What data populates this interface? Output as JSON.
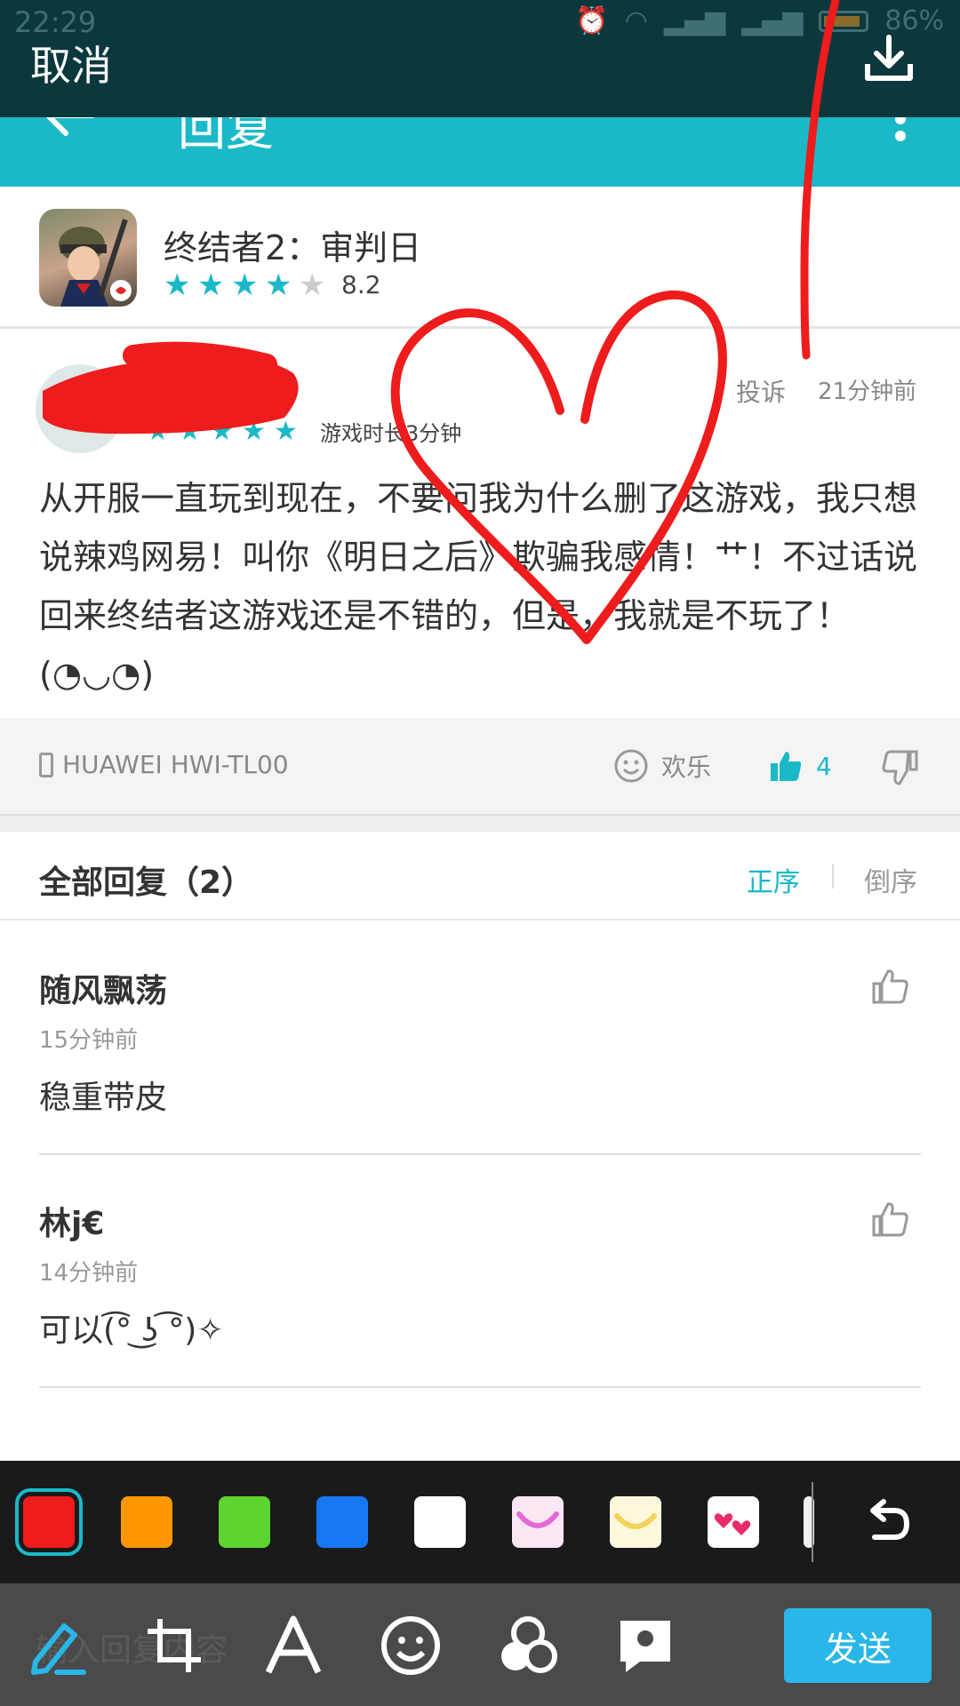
{
  "status_bar": {
    "time": "22:29",
    "battery": "86%"
  },
  "editor": {
    "cancel_label": "取消",
    "send_label": "发送"
  },
  "app_header": {
    "title": "回复"
  },
  "game": {
    "name": "终结者2：审判日",
    "score": "8.2",
    "rating_stars": 4
  },
  "review": {
    "playtime": "游戏时长3分钟",
    "report_label": "投诉",
    "time": "21分钟前",
    "text": "从开服一直玩到现在，不要问我为什么删了这游戏，我只想说辣鸡网易！叫你《明日之后》欺骗我感情！艹！不过话说回来终结者这游戏还是不错的，但是，我就是不玩了！(◔◡◔)",
    "stars": 5
  },
  "device_bar": {
    "device": "HUAWEI HWI-TL00",
    "mood": "欢乐",
    "likes": "4"
  },
  "replies": {
    "title": "全部回复（2）",
    "sort_asc": "正序",
    "sort_desc": "倒序",
    "items": [
      {
        "name": "随风飘荡",
        "time": "15分钟前",
        "text": "稳重带皮"
      },
      {
        "name": "林j€",
        "time": "14分钟前",
        "text": "可以(͡° ͜ʖ ͡°)✧"
      }
    ]
  },
  "reply_input": {
    "placeholder": "输入回复内容"
  },
  "palette": {
    "colors": [
      "#ee1c1c",
      "#ff9800",
      "#5ed431",
      "#1677f4",
      "#ffffff"
    ],
    "selected": "#ee1c1c",
    "accent": "#1bb9c8"
  },
  "icons": [
    "back-arrow-icon",
    "more-vert-icon",
    "download-icon",
    "phone-icon",
    "smile-icon",
    "thumbs-up-icon",
    "thumbs-down-icon",
    "undo-icon",
    "pen-icon",
    "crop-icon",
    "text-icon",
    "sticker-icon",
    "mosaic-icon",
    "pin-icon"
  ]
}
